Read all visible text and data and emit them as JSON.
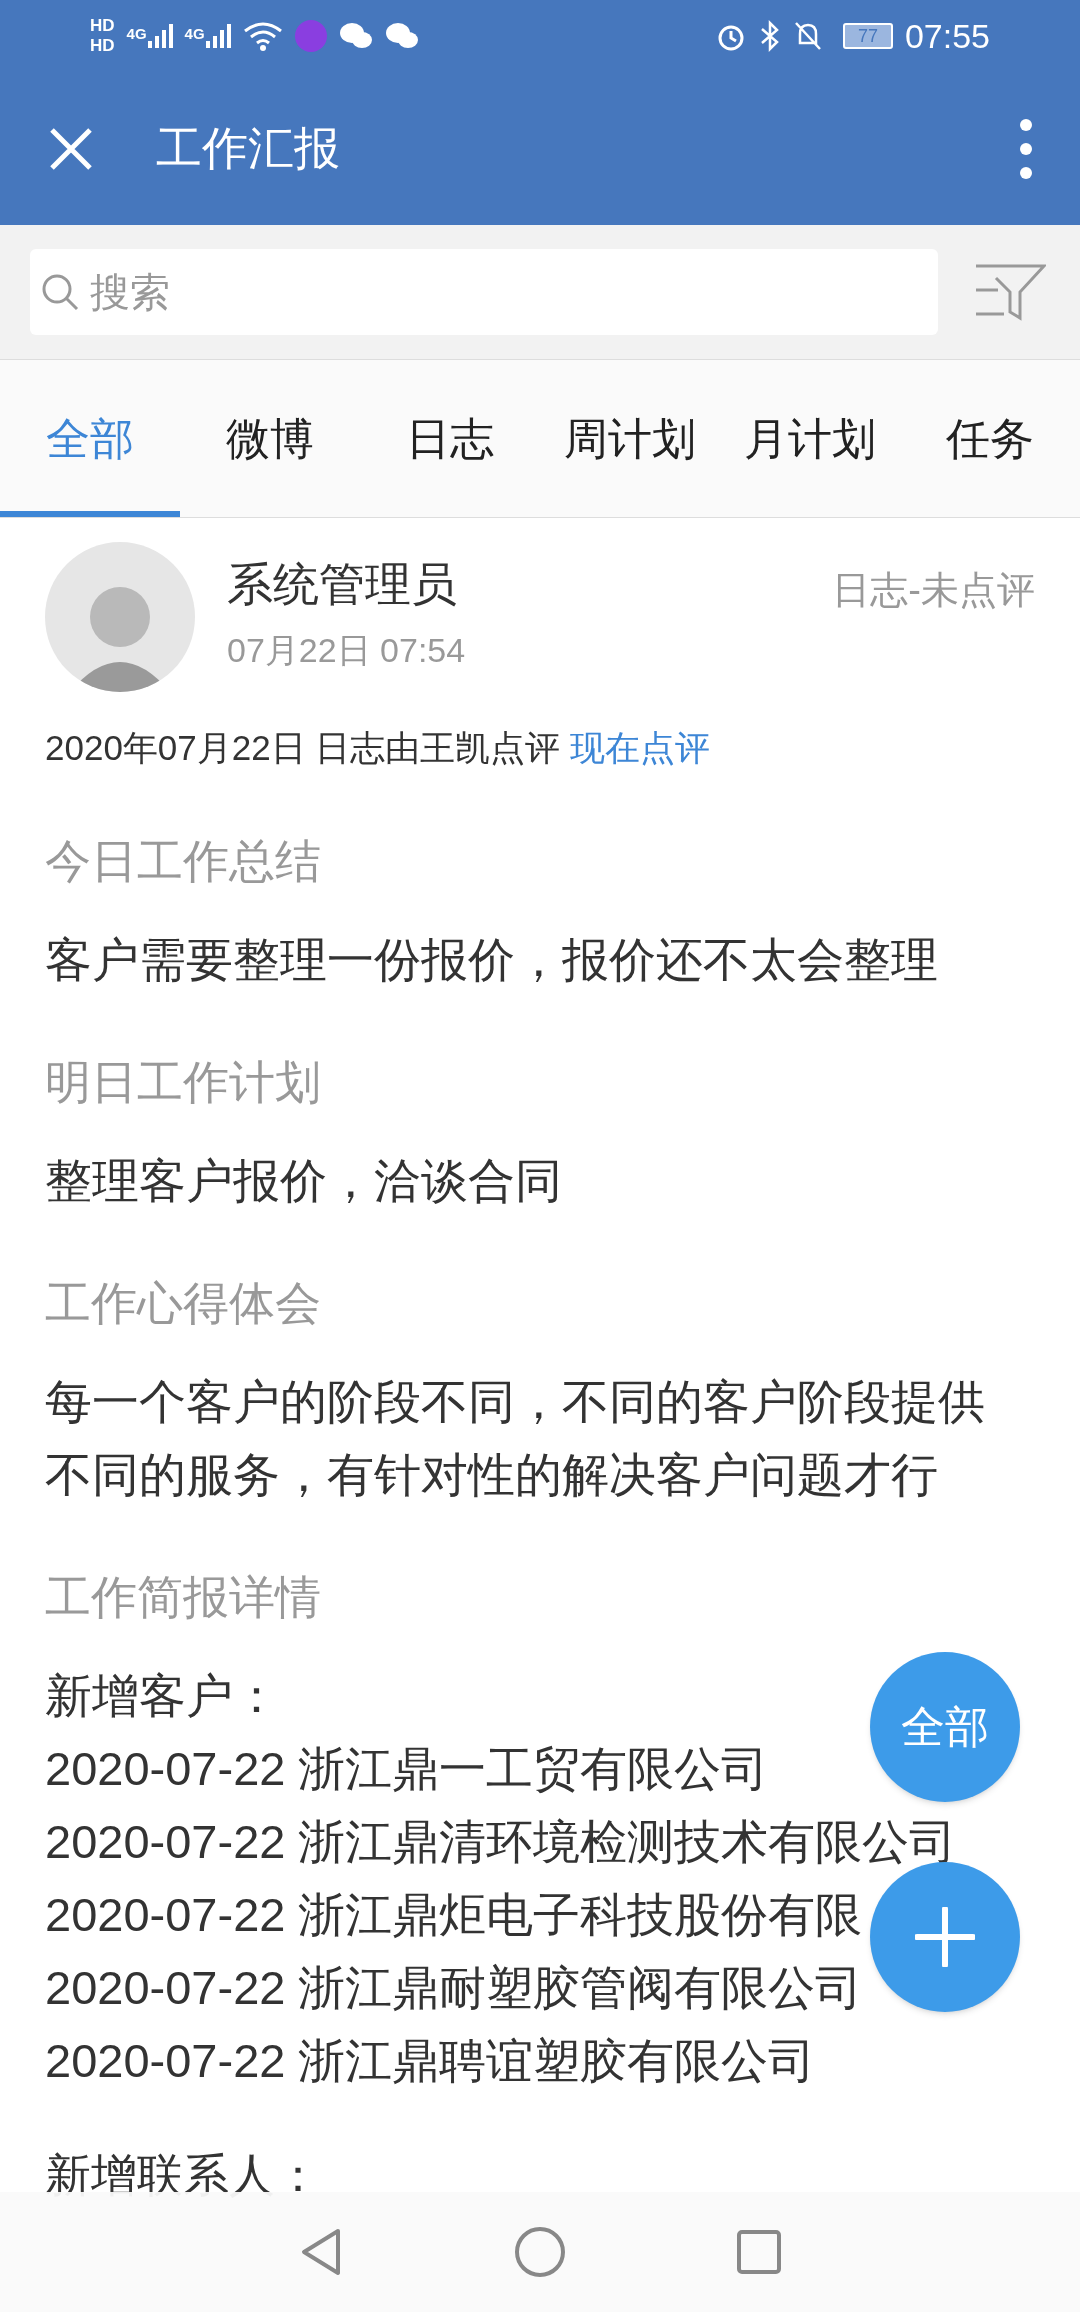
{
  "status_bar": {
    "sim_labels": [
      "HD",
      "HD"
    ],
    "network_labels": [
      "4G",
      "4G"
    ],
    "battery": "77",
    "time": "07:55"
  },
  "header": {
    "title": "工作汇报"
  },
  "search": {
    "placeholder": "搜索"
  },
  "tabs": [
    {
      "label": "全部",
      "selected": true
    },
    {
      "label": "微博",
      "selected": false
    },
    {
      "label": "日志",
      "selected": false
    },
    {
      "label": "周计划",
      "selected": false
    },
    {
      "label": "月计划",
      "selected": false
    },
    {
      "label": "任务",
      "selected": false
    }
  ],
  "post": {
    "author": "系统管理员",
    "time": "07月22日 07:54",
    "status": "日志-未点评",
    "review_note": "2020年07月22日 日志由王凯点评",
    "review_link": "现在点评",
    "sections": [
      {
        "heading": "今日工作总结",
        "lines": [
          "客户需要整理一份报价，报价还不太会整理"
        ]
      },
      {
        "heading": "明日工作计划",
        "lines": [
          "整理客户报价，洽谈合同"
        ]
      },
      {
        "heading": "工作心得体会",
        "lines": [
          "每一个客户的阶段不同，不同的客户阶段提供",
          "不同的服务，有针对性的解决客户问题才行"
        ]
      },
      {
        "heading": "工作简报详情",
        "lines": [
          "新增客户：",
          "2020-07-22 浙江鼎一工贸有限公司",
          "2020-07-22 浙江鼎清环境检测技术有限公司",
          "2020-07-22 浙江鼎炬电子科技股份有限",
          "2020-07-22 浙江鼎耐塑胶管阀有限公司",
          "2020-07-22 浙江鼎聘谊塑胶有限公司"
        ]
      }
    ],
    "trailing": "新增联系人："
  },
  "fab_filter": "全部"
}
